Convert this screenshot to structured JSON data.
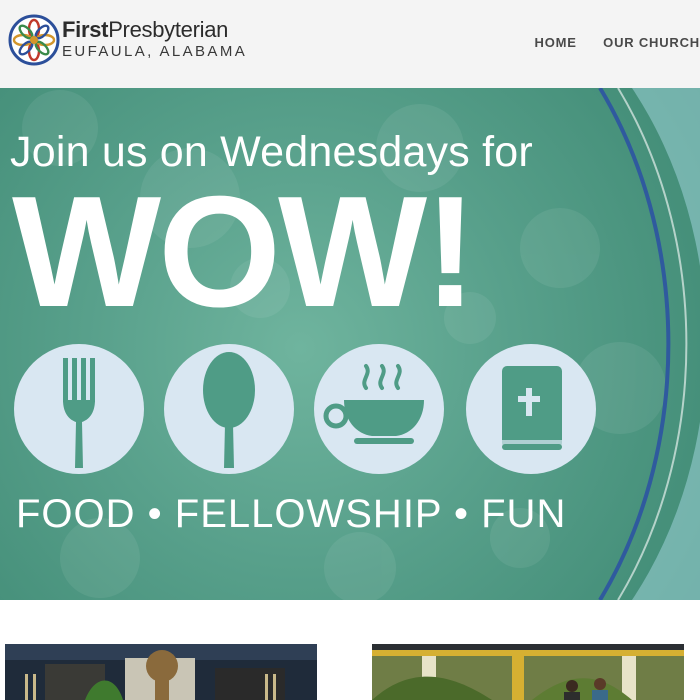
{
  "header": {
    "brand_first": "First",
    "brand_rest": "Presbyterian",
    "brand_location": "EUFAULA, ALABAMA",
    "nav": [
      {
        "label": "HOME"
      },
      {
        "label": "OUR CHURCH"
      }
    ]
  },
  "hero": {
    "tagline": "Join us on Wednesdays for",
    "title": "WOW!",
    "subtitle": "FOOD • FELLOWSHIP • FUN",
    "icons": [
      "fork-icon",
      "spoon-icon",
      "coffee-cup-icon",
      "bible-icon"
    ]
  },
  "colors": {
    "hero_green": "#58a08b",
    "icon_circle": "#d9e7f2",
    "ring_blue": "#2f5a9e"
  }
}
